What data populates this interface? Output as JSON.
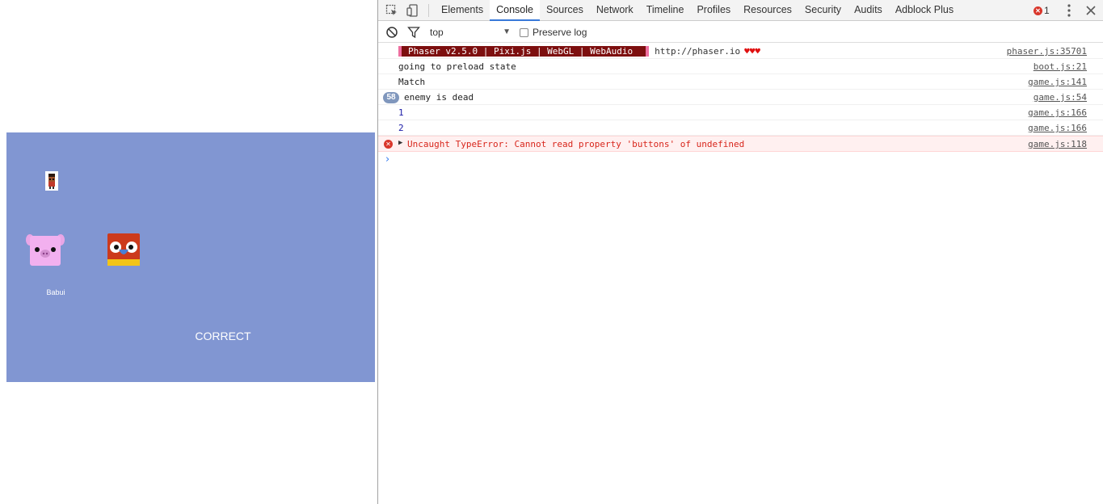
{
  "game": {
    "animal_name": "Babui",
    "result_text": "CORRECT"
  },
  "devtools": {
    "tabs": [
      {
        "label": "Elements"
      },
      {
        "label": "Console"
      },
      {
        "label": "Sources"
      },
      {
        "label": "Network"
      },
      {
        "label": "Timeline"
      },
      {
        "label": "Profiles"
      },
      {
        "label": "Resources"
      },
      {
        "label": "Security"
      },
      {
        "label": "Audits"
      },
      {
        "label": "Adblock Plus"
      }
    ],
    "active_tab": "Console",
    "error_count": "1",
    "colors": {
      "accent": "#3879d9",
      "error": "#d9362b",
      "canvas_bg": "#8196d2"
    }
  },
  "console": {
    "context": "top",
    "preserve_log_label": "Preserve log",
    "preserve_log_checked": false,
    "banner": {
      "text": "Phaser v2.5.0 | Pixi.js | WebGL | WebAudio",
      "url": "http://phaser.io",
      "hearts": "♥♥♥",
      "source": "phaser.js:35701"
    },
    "messages": [
      {
        "text": "going to preload state",
        "source": "boot.js:21"
      },
      {
        "text": "Match",
        "source": "game.js:141"
      },
      {
        "count": "58",
        "text": "enemy is dead",
        "source": "game.js:54"
      },
      {
        "text": "1",
        "source": "game.js:166"
      },
      {
        "text": "2",
        "source": "game.js:166"
      }
    ],
    "error": {
      "text": "Uncaught TypeError: Cannot read property 'buttons' of undefined",
      "source": "game.js:118"
    }
  }
}
